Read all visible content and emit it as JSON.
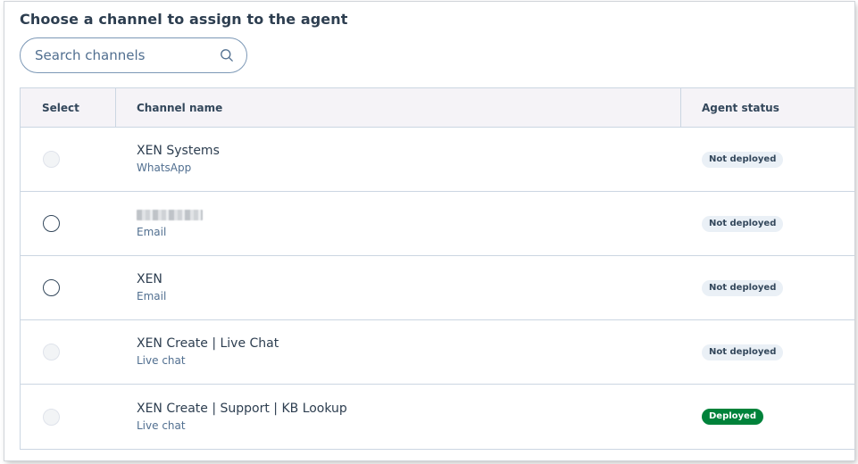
{
  "heading": "Choose a channel to assign to the agent",
  "search": {
    "placeholder": "Search channels",
    "icon": "search-icon"
  },
  "table": {
    "headers": {
      "select": "Select",
      "name": "Channel name",
      "status": "Agent status"
    },
    "rows": [
      {
        "name": "XEN Systems",
        "type": "WhatsApp",
        "selectable": false,
        "status": "Not deployed"
      },
      {
        "name": "",
        "name_redacted": true,
        "type": "Email",
        "selectable": true,
        "status": "Not deployed"
      },
      {
        "name": "XEN",
        "type": "Email",
        "selectable": true,
        "status": "Not deployed"
      },
      {
        "name": "XEN Create | Live Chat",
        "type": "Live chat",
        "selectable": false,
        "status": "Not deployed"
      },
      {
        "name": "XEN Create | Support | KB Lookup",
        "type": "Live chat",
        "selectable": false,
        "status": "Deployed"
      }
    ]
  },
  "colors": {
    "not_deployed_bg": "#eaf0f6",
    "not_deployed_text": "#33475b",
    "deployed_bg": "#00823a",
    "deployed_text": "#ffffff"
  }
}
